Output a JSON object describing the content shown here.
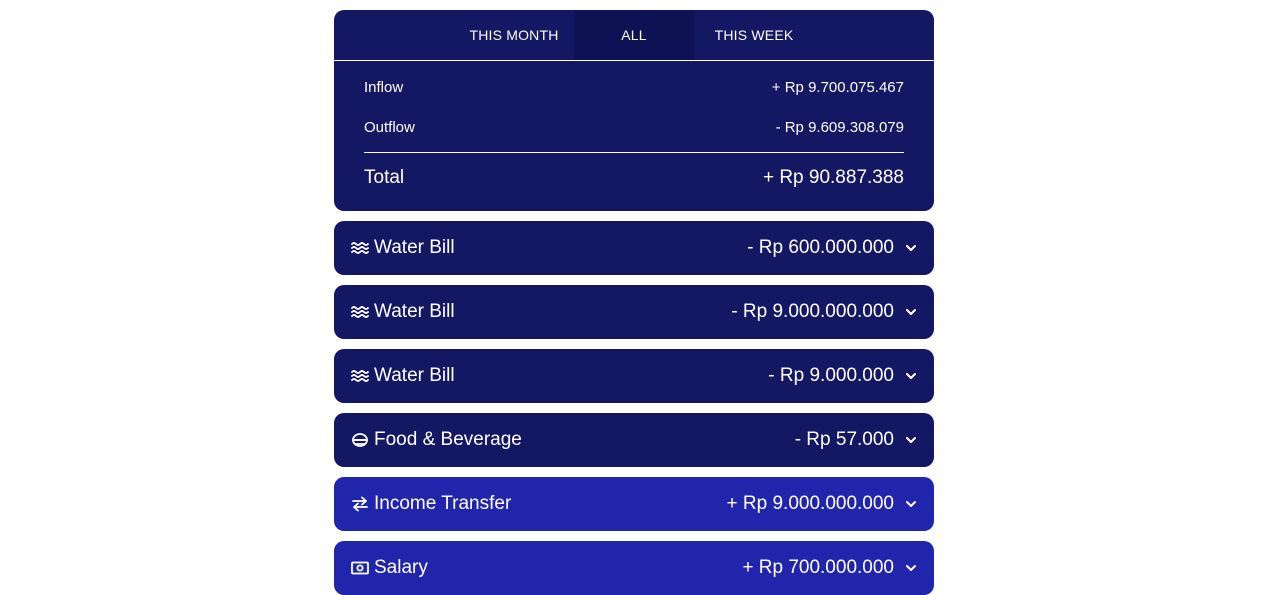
{
  "tabs": [
    {
      "label": "THIS MONTH",
      "active": false
    },
    {
      "label": "ALL",
      "active": true
    },
    {
      "label": "THIS WEEK",
      "active": false
    }
  ],
  "summary": {
    "inflow_label": "Inflow",
    "inflow_value": "+ Rp 9.700.075.467",
    "outflow_label": "Outflow",
    "outflow_value": "- Rp 9.609.308.079",
    "total_label": "Total",
    "total_value": "+ Rp 90.887.388"
  },
  "transactions": [
    {
      "icon": "water-icon",
      "name": "Water Bill",
      "amount": "- Rp 600.000.000",
      "type": "expense"
    },
    {
      "icon": "water-icon",
      "name": "Water Bill",
      "amount": "- Rp 9.000.000.000",
      "type": "expense"
    },
    {
      "icon": "water-icon",
      "name": "Water Bill",
      "amount": "- Rp 9.000.000",
      "type": "expense"
    },
    {
      "icon": "food-bowl-icon",
      "name": "Food & Beverage",
      "amount": "- Rp 57.000",
      "type": "expense"
    },
    {
      "icon": "transfer-arrows-icon",
      "name": "Income Transfer",
      "amount": "+ Rp 9.000.000.000",
      "type": "income"
    },
    {
      "icon": "cash-icon",
      "name": "Salary",
      "amount": "+ Rp 700.000.000",
      "type": "income"
    }
  ],
  "colors": {
    "expense_bg": "#141862",
    "income_bg": "#2125ab",
    "active_tab_bg": "#0e1154",
    "text": "#ffffff"
  }
}
